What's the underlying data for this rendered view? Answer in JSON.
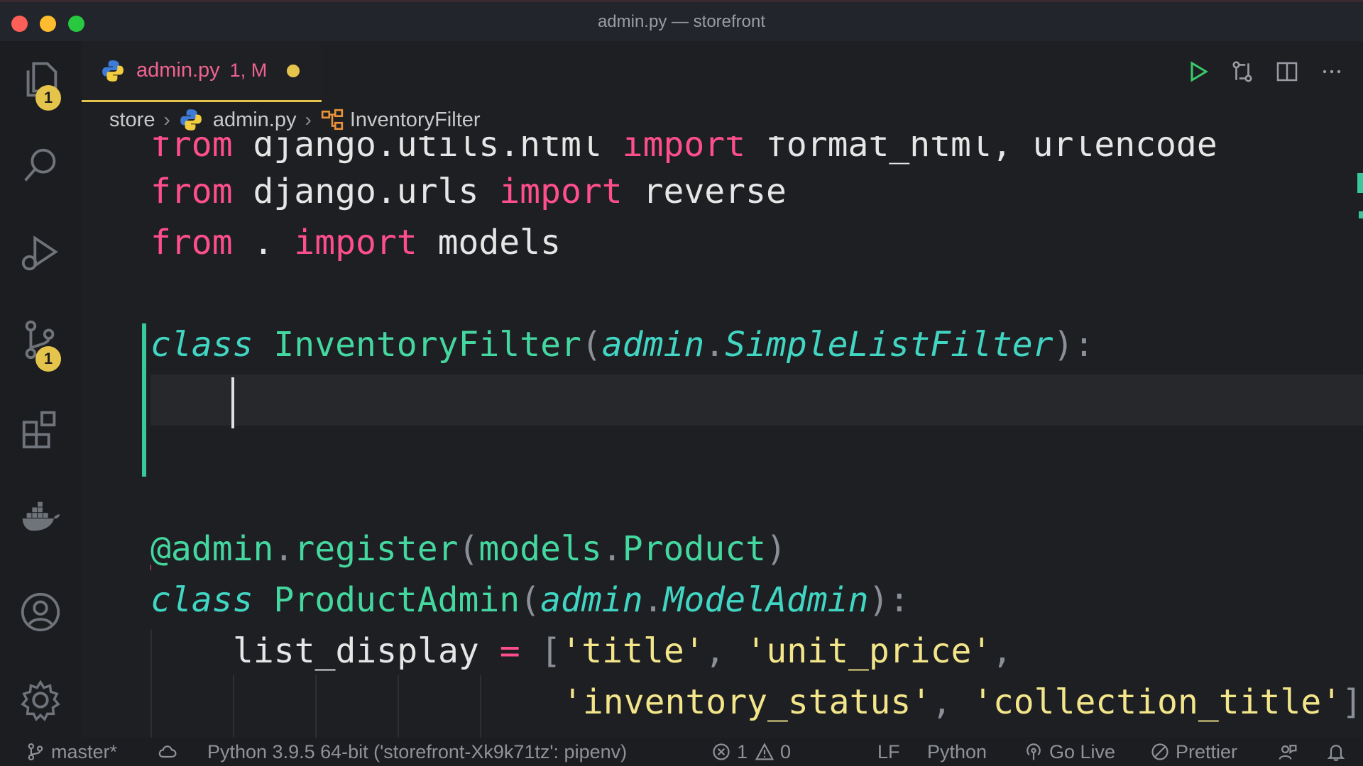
{
  "window": {
    "title": "admin.py — storefront"
  },
  "activity_bar": {
    "explorer_badge": "1",
    "source_control_badge": "1"
  },
  "tab": {
    "name": "admin.py",
    "status": "1, M"
  },
  "breadcrumbs": {
    "folder": "store",
    "file": "admin.py",
    "symbol": "InventoryFilter"
  },
  "code": {
    "line1": {
      "kw1": "from",
      "mod": " django.utils.html ",
      "kw2": "import",
      "rest": " format_html, urlencode"
    },
    "line2": {
      "kw1": "from",
      "mod": " django.urls ",
      "kw2": "import",
      "rest": " reverse"
    },
    "line3": {
      "kw1": "from",
      "mod": " . ",
      "kw2": "import",
      "rest": " models"
    },
    "line4": {
      "kw": "class",
      "name": " InventoryFilter",
      "open": "(",
      "base1": "admin",
      "dot": ".",
      "base2": "SimpleListFilter",
      "close": "):"
    },
    "line5": {
      "at": "@",
      "deco": "admin",
      "dot1": ".",
      "fn": "register",
      "open": "(",
      "arg1": "models",
      "dot2": ".",
      "arg2": "Product",
      "close": ")"
    },
    "line6": {
      "kw": "class",
      "name": " ProductAdmin",
      "open": "(",
      "base1": "admin",
      "dot": ".",
      "base2": "ModelAdmin",
      "close": "):"
    },
    "line7": {
      "var": "list_display ",
      "eq": "=",
      "open": " [",
      "s1": "'title'",
      "c1": ", ",
      "s2": "'unit_price'",
      "c2": ","
    },
    "line8": {
      "s3": "'inventory_status'",
      "c3": ", ",
      "s4": "'collection_title'",
      "close": "]"
    }
  },
  "status_bar": {
    "branch": "master*",
    "interpreter": "Python 3.9.5 64-bit ('storefront-Xk9k71tz': pipenv)",
    "errors": "1",
    "warnings": "0",
    "eol": "LF",
    "language": "Python",
    "go_live": "Go Live",
    "prettier": "Prettier"
  },
  "colors": {
    "keyword": "#ff4f8b",
    "class_name": "#44d7a0",
    "italic_type": "#41d6c3",
    "string": "#f3e58a",
    "badge": "#e5c44c",
    "tab_modified": "#f0638f"
  }
}
